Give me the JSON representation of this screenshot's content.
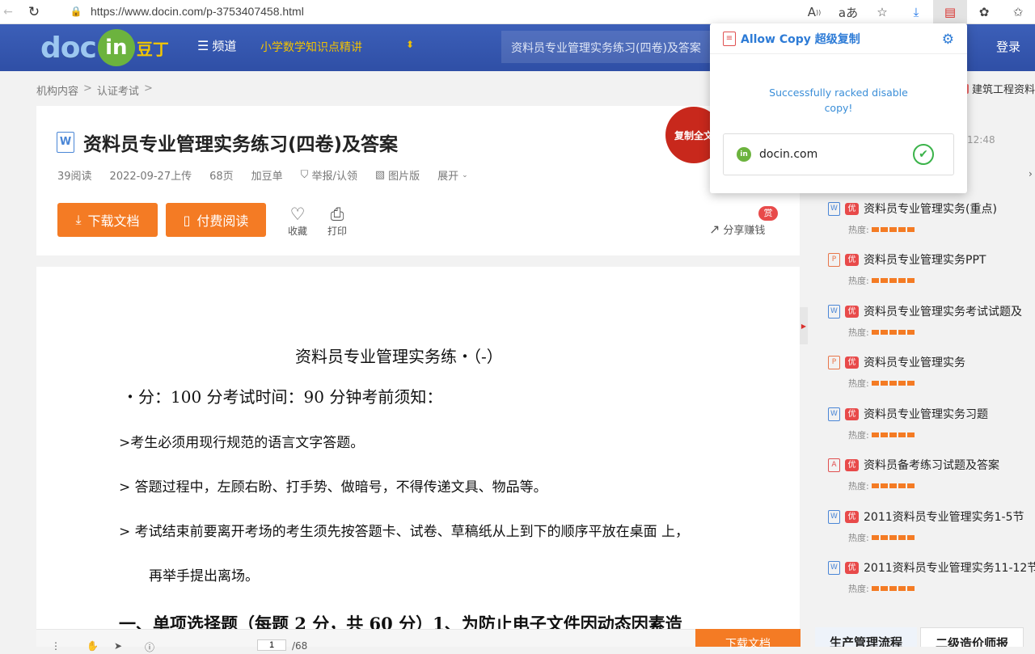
{
  "browser": {
    "url": "https://www.docin.com/p-3753407458.html",
    "icons": [
      "read-aloud-icon",
      "translate-icon",
      "favorites-add-icon",
      "download-icon",
      "extension-allow-copy-icon",
      "extensions-icon",
      "favorites-icon"
    ]
  },
  "header": {
    "logo_doc": "doc",
    "logo_in": "in",
    "logo_cn": "豆丁",
    "channel_label": "频道",
    "hot_topic": "小学数学知识点精讲",
    "search_text": "资料员专业管理实务练习(四卷)及答案",
    "login": "登录"
  },
  "breadcrumb": [
    "机构内容",
    "认证考试"
  ],
  "doc": {
    "type_icon": "W",
    "title": "资料员专业管理实务练习(四卷)及答案",
    "meta": {
      "reads": "39阅读",
      "upload": "2022-09-27上传",
      "pages": "68页",
      "add_list": "加豆单",
      "report": "举报/认领",
      "image_version": "图片版",
      "expand": "展开"
    },
    "download_label": "下载文档",
    "pay_read_label": "付费阅读",
    "favorite_label": "收藏",
    "print_label": "打印",
    "share_label": "分享赚钱",
    "reward_badge": "赏",
    "copy_all": "复制全文"
  },
  "content": {
    "title": "资料员专业管理实务练・（-）",
    "line1": "・分：100 分考试时间：90 分钟考前须知：",
    "line2": ">考生必须用现行规范的语言文字答题。",
    "line3": "> 答题过程中，左顾右盼、打手势、做暗号，不得传递文具、物品等。",
    "line4": "> 考试结束前要离开考场的考生须先按答题卡、试卷、草稿纸从上到下的顺序平放在桌面 上，",
    "line5": "再举手提出离场。",
    "line6": "一、单项选择题（每题 2 分，共 60 分）1、为防止电子文件因动态因素造"
  },
  "bottom_bar": {
    "current_page": "1",
    "total_pages": "/68",
    "download_label": "下载文档"
  },
  "sidebar": {
    "top_link": "建筑工程资料",
    "time": "12:48",
    "heat_label": "热度:",
    "related": [
      {
        "type": "W",
        "title": "资料员专业管理实务(重点)"
      },
      {
        "type": "P",
        "title": "资料员专业管理实务PPT"
      },
      {
        "type": "W",
        "title": "资料员专业管理实务考试试题及"
      },
      {
        "type": "P",
        "title": "资料员专业管理实务"
      },
      {
        "type": "W",
        "title": "资料员专业管理实务习题"
      },
      {
        "type": "PDF",
        "title": "资料员备考练习试题及答案"
      },
      {
        "type": "W",
        "title": "2011资料员专业管理实务1-5节"
      },
      {
        "type": "W",
        "title": "2011资料员专业管理实务11-12节"
      }
    ],
    "badge": "优",
    "tabs": [
      "生产管理流程",
      "二级造价师报"
    ]
  },
  "popup": {
    "title": "Allow Copy 超级复制",
    "message_line1": "Successfully racked disable",
    "message_line2": "copy!",
    "site": "docin.com"
  }
}
